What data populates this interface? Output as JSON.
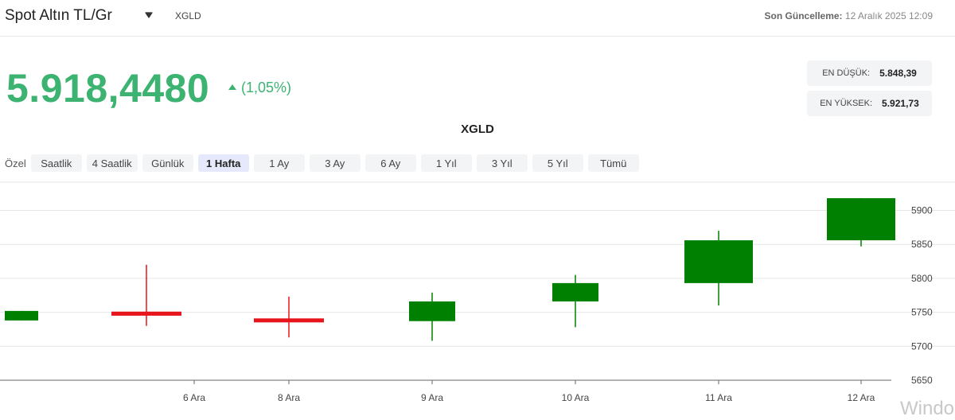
{
  "header": {
    "title": "Spot Altın TL/Gr",
    "symbol": "XGLD",
    "updated_label": "Son Güncelleme:",
    "updated_value": "12 Aralık 2025 12:09"
  },
  "quote": {
    "price": "5.918,4480",
    "change": "(1,05%)",
    "low_label": "EN DÜŞÜK:",
    "low_value": "5.848,39",
    "high_label": "EN YÜKSEK:",
    "high_value": "5.921,73"
  },
  "range_bar": {
    "custom_label": "Özel",
    "options": [
      "Saatlik",
      "4 Saatlik",
      "Günlük",
      "1 Hafta",
      "1 Ay",
      "3 Ay",
      "6 Ay",
      "1 Yıl",
      "3 Yıl",
      "5 Yıl",
      "Tümü"
    ],
    "selected": "1 Hafta"
  },
  "colors": {
    "up": "#008000",
    "down": "#e8141b",
    "accent_text": "#3cb371"
  },
  "watermark": "Windo",
  "chart_data": {
    "type": "candlestick",
    "title": "XGLD",
    "ylim": [
      5650,
      5930
    ],
    "yticks": [
      5650,
      5700,
      5750,
      5800,
      5850,
      5900
    ],
    "grid": true,
    "candles": [
      {
        "label": "",
        "open": 5738,
        "close": 5752,
        "high": 5752,
        "low": 5738
      },
      {
        "label": "6 Ara",
        "open": 5751,
        "close": 5745,
        "high": 5820,
        "low": 5730
      },
      {
        "label": "8 Ara",
        "open": 5741,
        "close": 5737,
        "high": 5773,
        "low": 5713
      },
      {
        "label": "9 Ara",
        "open": 5737,
        "close": 5766,
        "high": 5779,
        "low": 5708
      },
      {
        "label": "10 Ara",
        "open": 5766,
        "close": 5793,
        "high": 5805,
        "low": 5728
      },
      {
        "label": "11 Ara",
        "open": 5793,
        "close": 5856,
        "high": 5870,
        "low": 5760
      },
      {
        "label": "12 Ara",
        "open": 5856,
        "close": 5918,
        "high": 5918,
        "low": 5847
      }
    ]
  }
}
